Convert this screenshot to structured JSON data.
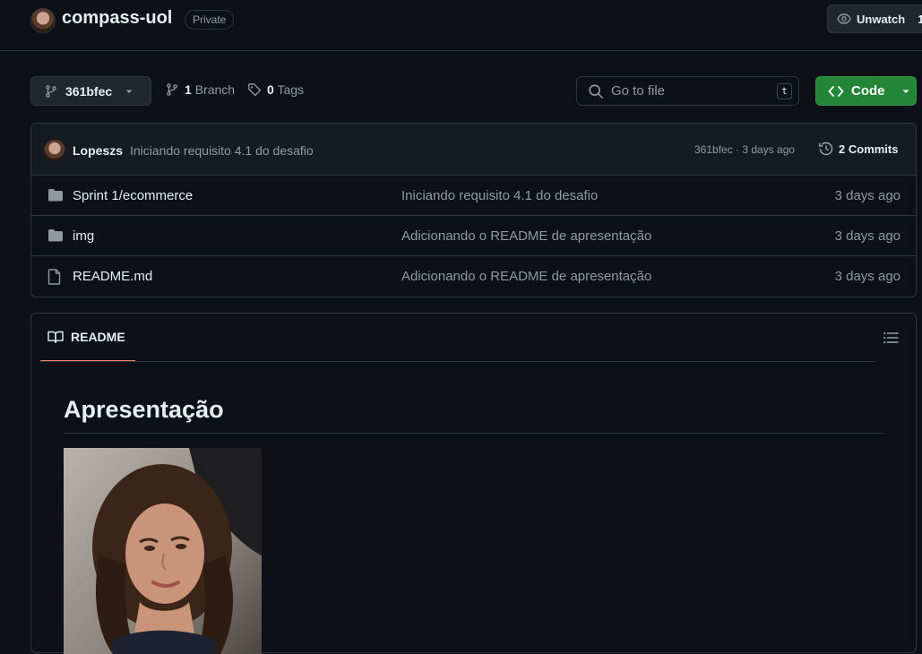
{
  "repo": {
    "name": "compass-uol",
    "visibility": "Private",
    "watch_label": "Unwatch",
    "watch_count": "1"
  },
  "toolbar": {
    "branch_name": "361bfec",
    "branch_count": "1",
    "branch_label": "Branch",
    "tag_count": "0",
    "tag_label": "Tags",
    "search_placeholder": "Go to file",
    "search_shortcut": "t",
    "code_label": "Code"
  },
  "last_commit": {
    "author": "Lopeszs",
    "message": "Iniciando requisito 4.1 do desafio",
    "meta": "361bfec · 3 days ago",
    "commits_count": "2",
    "commits_label": "Commits"
  },
  "files": [
    {
      "name": "Sprint 1/ecommerce",
      "type": "folder",
      "message": "Iniciando requisito 4.1 do desafio",
      "date": "3 days ago"
    },
    {
      "name": "img",
      "type": "folder",
      "message": "Adicionando o README de apresentação",
      "date": "3 days ago"
    },
    {
      "name": "README.md",
      "type": "file",
      "message": "Adicionando o README de apresentação",
      "date": "3 days ago"
    }
  ],
  "readme": {
    "tab_label": "README",
    "title": "Apresentação"
  },
  "colors": {
    "background": "#0d1117",
    "border": "#30363d",
    "code_button": "#238636",
    "tab_underline": "#f78166"
  }
}
